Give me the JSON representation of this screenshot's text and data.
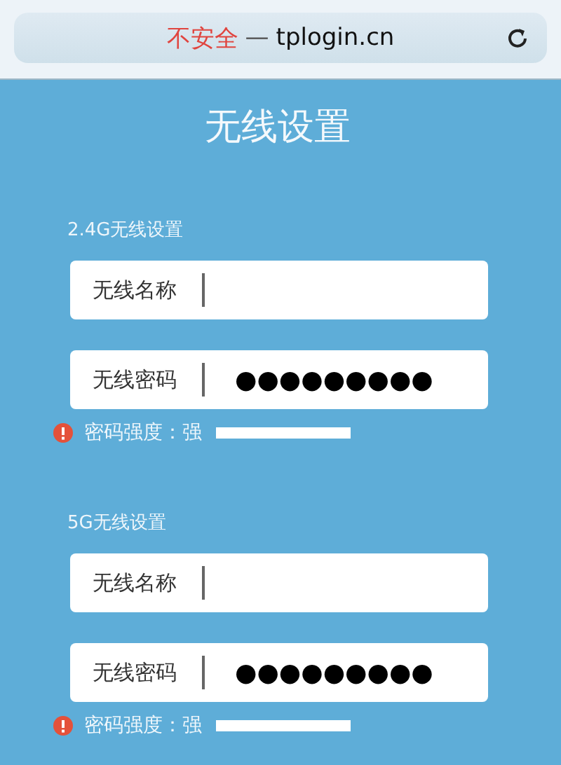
{
  "address_bar": {
    "security": "不安全",
    "separator": "—",
    "url": "tplogin.cn"
  },
  "title": "无线设置",
  "sections": [
    {
      "heading": "2.4G无线设置",
      "fields": [
        {
          "kind": "text",
          "label": "无线名称"
        },
        {
          "kind": "password",
          "label": "无线密码",
          "value": "●●●●●●●●●"
        }
      ],
      "strength": {
        "label": "密码强度：强",
        "level": 1
      }
    },
    {
      "heading": "5G无线设置",
      "fields": [
        {
          "kind": "text",
          "label": "无线名称"
        },
        {
          "kind": "password",
          "label": "无线密码",
          "value": "●●●●●●●●●"
        }
      ],
      "strength": {
        "label": "密码强度：强",
        "level": 1
      }
    }
  ]
}
